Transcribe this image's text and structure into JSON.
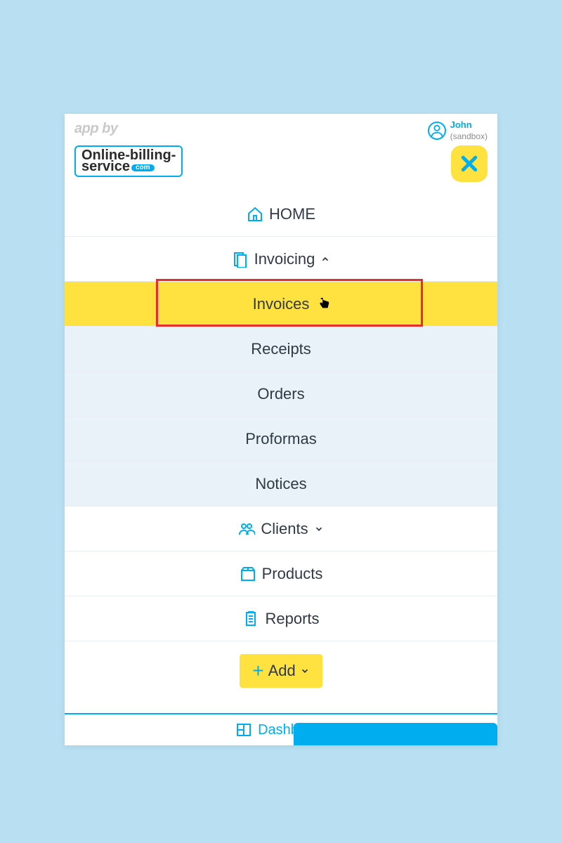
{
  "header": {
    "app_by": "app by",
    "user_name": "John",
    "user_sandbox": "(sandbox)",
    "logo_line1": "Online-billing-",
    "logo_line2": "service",
    "logo_badge": "com"
  },
  "nav": {
    "home": "HOME",
    "invoicing": "Invoicing",
    "sub": {
      "invoices": "Invoices",
      "receipts": "Receipts",
      "orders": "Orders",
      "proformas": "Proformas",
      "notices": "Notices"
    },
    "clients": "Clients",
    "products": "Products",
    "reports": "Reports",
    "add": "Add"
  },
  "bottom": {
    "dashboard": "Dashboard"
  },
  "colors": {
    "accent": "#00AEEF",
    "highlight": "#FFE23F",
    "annotation": "#E52E2E"
  }
}
